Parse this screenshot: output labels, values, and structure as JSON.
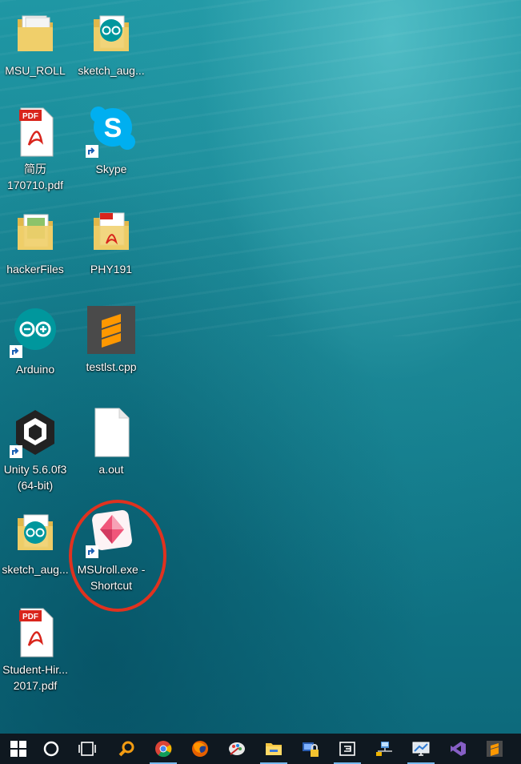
{
  "desktop": {
    "icons": [
      {
        "label": "MSU_ROLL"
      },
      {
        "label": "sketch_aug..."
      },
      {
        "label": "简历\n170710.pdf"
      },
      {
        "label": "Skype"
      },
      {
        "label": "hackerFiles"
      },
      {
        "label": "PHY191"
      },
      {
        "label": "Arduino"
      },
      {
        "label": "testlst.cpp"
      },
      {
        "label": "Unity 5.6.0f3\n(64-bit)"
      },
      {
        "label": "a.out"
      },
      {
        "label": "sketch_aug..."
      },
      {
        "label": "MSUroll.exe -\nShortcut"
      },
      {
        "label": "Student-Hir...\n2017.pdf"
      }
    ],
    "pdf_badge": "PDF",
    "highlight_color": "#e0321f"
  },
  "taskbar": {
    "items": [
      "windows-start",
      "cortana",
      "task-view",
      "search-app",
      "chrome",
      "firefox",
      "paint-app",
      "file-explorer",
      "security-app",
      "terminal-app",
      "network-app",
      "remote-desktop",
      "visual-studio",
      "sublime-text"
    ]
  }
}
